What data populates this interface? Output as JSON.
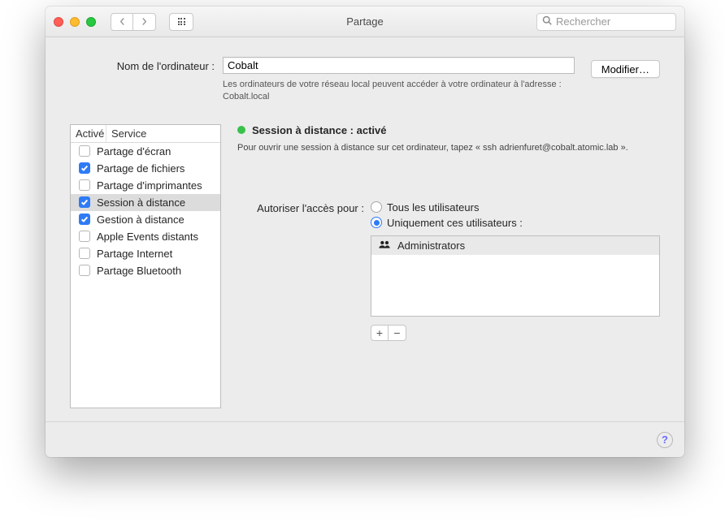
{
  "window": {
    "title": "Partage",
    "search_placeholder": "Rechercher"
  },
  "computer_name": {
    "label": "Nom de l'ordinateur :",
    "value": "Cobalt",
    "help": "Les ordinateurs de votre réseau local peuvent accéder à votre ordinateur à l'adresse : Cobalt.local",
    "modify_label": "Modifier…"
  },
  "service_list": {
    "header_active": "Activé",
    "header_service": "Service",
    "items": [
      {
        "label": "Partage d'écran",
        "checked": false,
        "selected": false
      },
      {
        "label": "Partage de fichiers",
        "checked": true,
        "selected": false
      },
      {
        "label": "Partage d'imprimantes",
        "checked": false,
        "selected": false
      },
      {
        "label": "Session à distance",
        "checked": true,
        "selected": true
      },
      {
        "label": "Gestion à distance",
        "checked": true,
        "selected": false
      },
      {
        "label": "Apple Events distants",
        "checked": false,
        "selected": false
      },
      {
        "label": "Partage Internet",
        "checked": false,
        "selected": false
      },
      {
        "label": "Partage Bluetooth",
        "checked": false,
        "selected": false
      }
    ]
  },
  "detail": {
    "status_label": "Session à distance : activé",
    "instruction": "Pour ouvrir une session à distance sur cet ordinateur, tapez « ssh adrienfuret@cobalt.atomic.lab ».",
    "access_label": "Autoriser l'accès pour :",
    "radio_all": "Tous les utilisateurs",
    "radio_only": "Uniquement ces utilisateurs :",
    "radio_selected": "only",
    "users": [
      {
        "name": "Administrators"
      }
    ]
  },
  "footer": {
    "help_char": "?"
  }
}
